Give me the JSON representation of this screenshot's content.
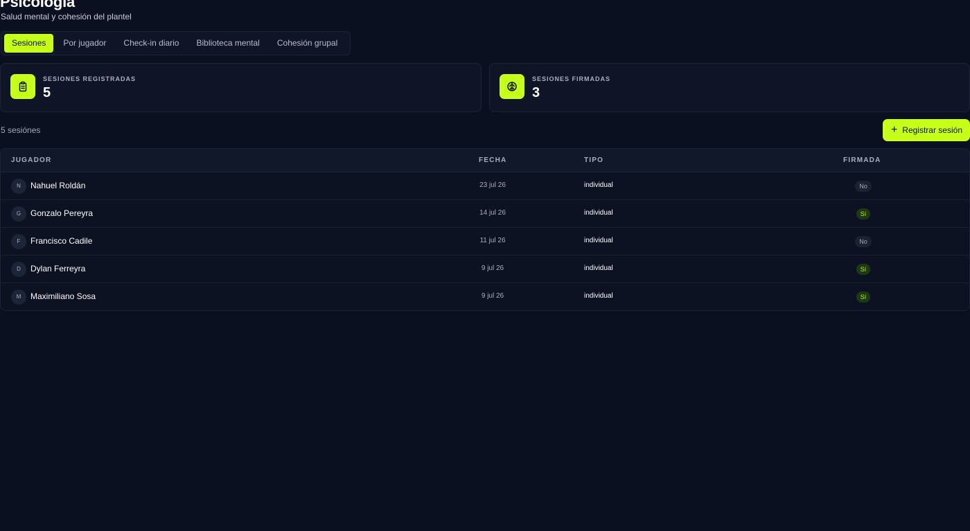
{
  "header": {
    "title": "Psicología",
    "subtitle": "Salud mental y cohesión del plantel"
  },
  "tabs": [
    {
      "label": "Sesiones",
      "active": true
    },
    {
      "label": "Por jugador",
      "active": false
    },
    {
      "label": "Check-in diario",
      "active": false
    },
    {
      "label": "Biblioteca mental",
      "active": false
    },
    {
      "label": "Cohesión grupal",
      "active": false
    }
  ],
  "stats": [
    {
      "icon": "clipboard-icon",
      "label": "SESIONES REGISTRADAS",
      "value": "5"
    },
    {
      "icon": "brain-icon",
      "label": "SESIONES FIRMADAS",
      "value": "3"
    }
  ],
  "list": {
    "count_text": "5 sesiónes",
    "add_button_label": "Registrar sesión",
    "add_button_icon": "plus-icon"
  },
  "table": {
    "columns": {
      "player": "JUGADOR",
      "date": "FECHA",
      "type": "TIPO",
      "signed": "FIRMADA"
    },
    "rows": [
      {
        "initial": "N",
        "player": "Nahuel Roldán",
        "date": "23 jul 26",
        "type": "individual",
        "signed": "No"
      },
      {
        "initial": "G",
        "player": "Gonzalo Pereyra",
        "date": "14 jul 26",
        "type": "individual",
        "signed": "Sí"
      },
      {
        "initial": "F",
        "player": "Francisco Cadile",
        "date": "11 jul 26",
        "type": "individual",
        "signed": "No"
      },
      {
        "initial": "D",
        "player": "Dylan Ferreyra",
        "date": "9 jul 26",
        "type": "individual",
        "signed": "Sí"
      },
      {
        "initial": "M",
        "player": "Maximiliano Sosa",
        "date": "9 jul 26",
        "type": "individual",
        "signed": "Sí"
      }
    ]
  },
  "colors": {
    "background": "#0b1020",
    "accent": "#c6ff1a",
    "card": "#0f1526",
    "signed_yes_bg": "#1e3a12",
    "signed_yes_text": "#b7f03a"
  }
}
